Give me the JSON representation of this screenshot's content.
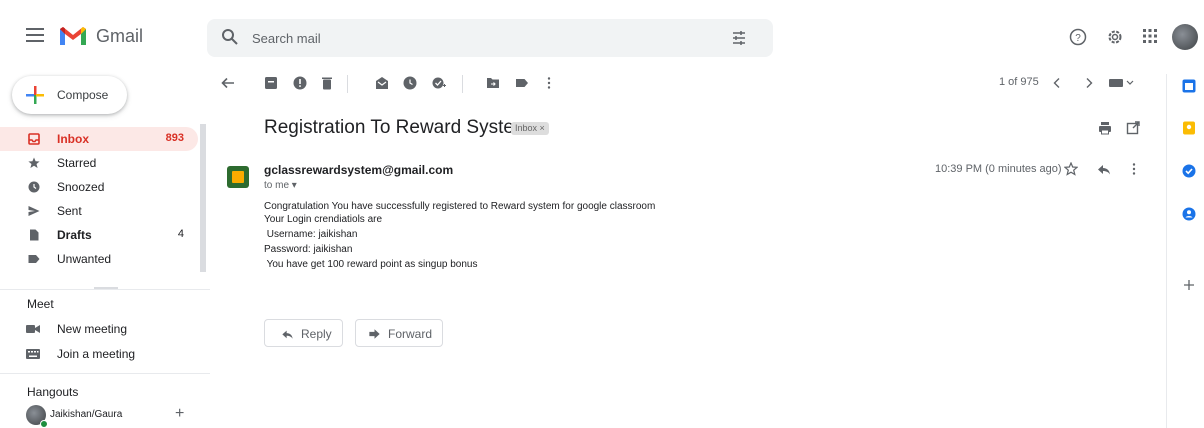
{
  "header": {
    "app_name": "Gmail",
    "search_placeholder": "Search mail"
  },
  "sidebar": {
    "compose_label": "Compose",
    "items": [
      {
        "label": "Inbox",
        "count": "893"
      },
      {
        "label": "Starred",
        "count": ""
      },
      {
        "label": "Snoozed",
        "count": ""
      },
      {
        "label": "Sent",
        "count": ""
      },
      {
        "label": "Drafts",
        "count": "4"
      },
      {
        "label": "Unwanted",
        "count": ""
      }
    ],
    "meet": {
      "title": "Meet",
      "items": [
        {
          "label": "New meeting"
        },
        {
          "label": "Join a meeting"
        }
      ]
    },
    "hangouts": {
      "title": "Hangouts",
      "contact_name": "Jaikishan/Gaura"
    }
  },
  "toolbar": {
    "page_count": "1 of 975"
  },
  "message": {
    "subject": "Registration To Reward System",
    "label_chip": "Inbox ×",
    "sender": "gclassrewardsystem@gmail.com",
    "recipient": "to me",
    "time": "10:39 PM (0 minutes ago)",
    "body": [
      "Congratulation You have successfully registered to Reward system for google classroom",
      "Your Login crendiatiols are",
      " Username: jaikishan",
      "Password: jaikishan",
      " You have get 100 reward point as singup bonus"
    ]
  },
  "actions": {
    "reply_label": "Reply",
    "forward_label": "Forward"
  },
  "colors": {
    "accent_red": "#d93025",
    "active_bg": "#fce8e6"
  },
  "icons": [
    "menu-icon",
    "gmail-logo",
    "search-icon",
    "tune-icon",
    "help-icon",
    "settings-icon",
    "apps-icon",
    "back-icon",
    "archive-icon",
    "report-spam-icon",
    "delete-icon",
    "mark-unread-icon",
    "snooze-icon",
    "add-task-icon",
    "move-to-icon",
    "label-icon",
    "more-icon",
    "newer-icon",
    "older-icon",
    "input-tools-icon",
    "print-icon",
    "open-new-window-icon",
    "star-icon",
    "reply-icon",
    "calendar-icon",
    "keep-icon",
    "tasks-icon",
    "contacts-icon",
    "add-addon-icon"
  ]
}
